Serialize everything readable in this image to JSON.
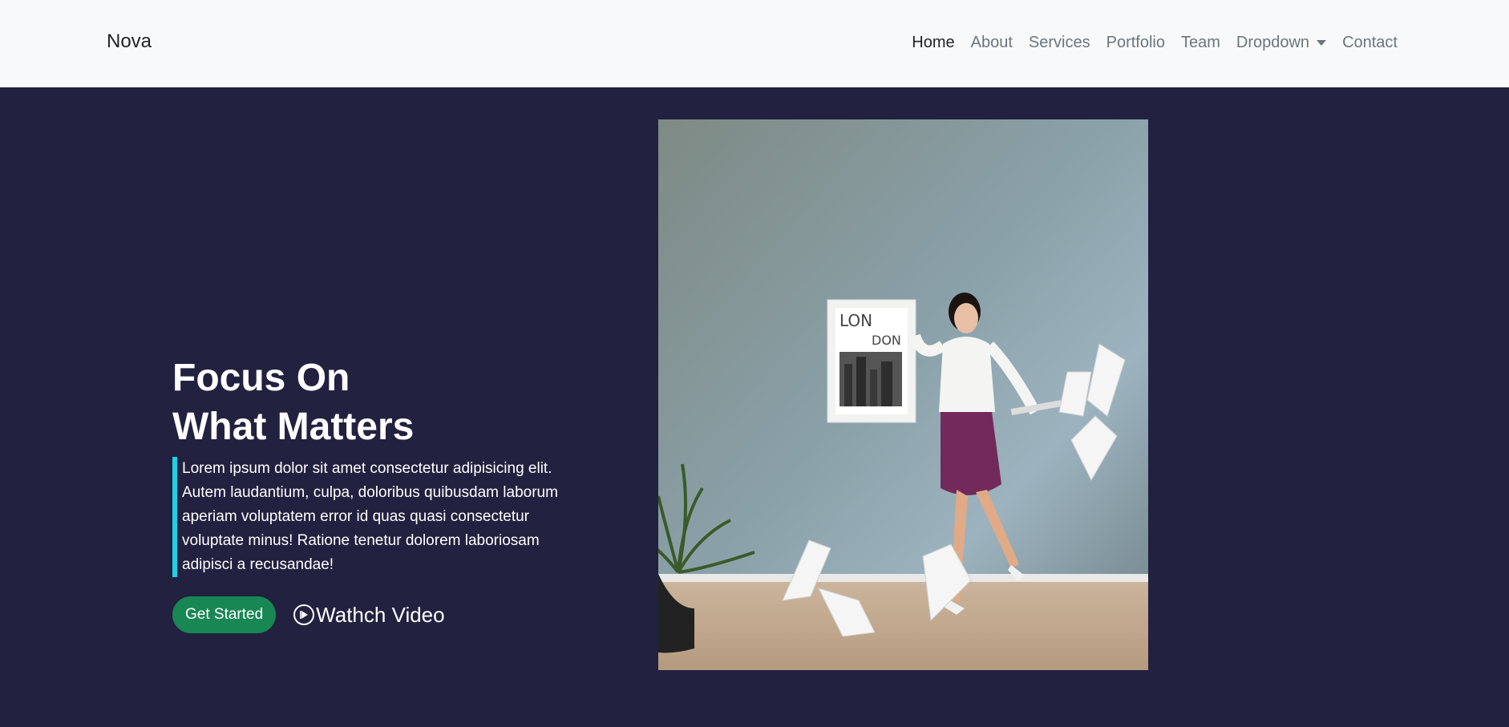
{
  "brand": "Nova",
  "nav": {
    "items": [
      {
        "label": "Home"
      },
      {
        "label": "About"
      },
      {
        "label": "Services"
      },
      {
        "label": "Portfolio"
      },
      {
        "label": "Team"
      },
      {
        "label": "Dropdown"
      },
      {
        "label": "Contact"
      }
    ]
  },
  "hero": {
    "title_line1": "Focus On",
    "title_line2": "What Matters",
    "text": "Lorem ipsum dolor sit amet consectetur adipisicing elit. Autem laudantium, culpa, doloribus quibusdam laborum aperiam voluptatem error id quas quasi consectetur voluptate minus! Ratione tenetur dolorem laboriosam adipisci a recusandae!",
    "primary_button": "Get Started",
    "video_link": "Wathch Video",
    "image": {
      "poster_line1": "LON",
      "poster_line2": "DON"
    }
  },
  "colors": {
    "navbar_bg": "#f8f9fa",
    "hero_bg": "#222140",
    "accent": "#1fd1e6",
    "button": "#198754"
  },
  "icons": [
    "caret-down-icon",
    "play-circle-icon"
  ]
}
